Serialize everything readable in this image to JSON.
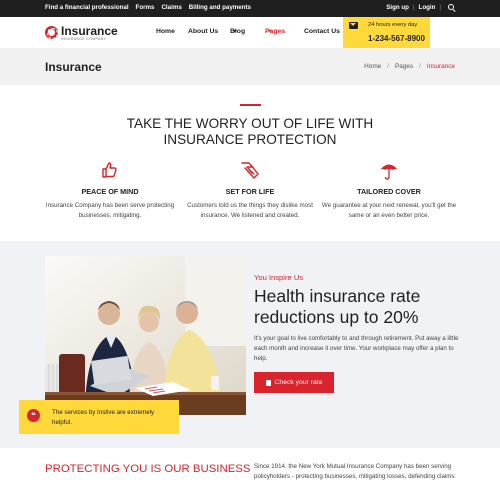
{
  "topbar": {
    "links": [
      "Find a financial professional",
      "Forms",
      "Claims",
      "Billing and payments"
    ],
    "signup": "Sign up",
    "separator": "|",
    "login": "Login",
    "login_separator": "|"
  },
  "brand": {
    "name": "Insurance",
    "tagline": "INSURANCE COMPANY",
    "accent": "#d9232d",
    "highlight": "#ffd93a"
  },
  "nav": {
    "items": [
      {
        "label": "Home",
        "dropdown": false,
        "active": false
      },
      {
        "label": "About Us",
        "dropdown": false,
        "active": false
      },
      {
        "label": "Blog",
        "dropdown": true,
        "active": false
      },
      {
        "label": "Pages",
        "dropdown": true,
        "active": true
      },
      {
        "label": "Contact Us",
        "dropdown": false,
        "active": false
      }
    ],
    "call_hours": "24 hours every day",
    "call_number": "1-234-567-8900"
  },
  "page": {
    "title": "Insurance",
    "breadcrumbs": [
      "Home",
      "Pages",
      "Insurance"
    ],
    "breadcrumb_separator": "/"
  },
  "intro": {
    "headline": "TAKE THE WORRY OUT OF LIFE WITH INSURANCE PROTECTION"
  },
  "features": [
    {
      "icon": "thumbs-up-icon",
      "title": "PEACE OF MIND",
      "desc": "Insurance Company has been serve protecting businesses, mitigating."
    },
    {
      "icon": "handshake-icon",
      "title": "SET FOR LIFE",
      "desc": "Customers told us the things they dislike most insurance. We listened and created."
    },
    {
      "icon": "umbrella-icon",
      "title": "TAILORED COVER",
      "desc": "We guarantee at your next renewal, you'll get the same or an even better price."
    }
  ],
  "promo": {
    "eyebrow": "You Inspire Us",
    "title": "Health insurance rate reductions up to 20%",
    "body": "It's your goal to live comfortably to and through retirement. Put away a little each month and increase it over time. Your workplace may offer a plan to help.",
    "button": "Check your rate",
    "quote_mark": "❝",
    "quote": "The services by Instive are extremely helpful."
  },
  "bottom": {
    "heading": "PROTECTING YOU IS OUR BUSINESS",
    "text": "Since 1914, the New York Mutual Insurance Company has been serving policyholders - protecting businesses, mitigating losses, defending claims"
  }
}
